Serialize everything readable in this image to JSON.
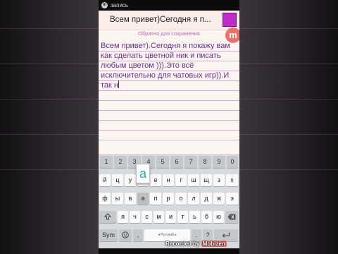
{
  "status_bar": {
    "recording_label": "запись",
    "recording_icon": "m"
  },
  "header": {
    "title": "Всем привет)Сегодня я п...",
    "selected_color": "#c02ac6"
  },
  "hint": "Обратно для сохранения",
  "badge": "m",
  "editor": {
    "text": "Всем привет).Сегодня я покажу вам как сделать цветной ник и писать любым цветом ))).Это всё исключительно для чатовых игр)).И так н"
  },
  "keyboard": {
    "popup": "а",
    "numbers": [
      "1",
      "2",
      "3",
      "4",
      "5",
      "6",
      "7",
      "8",
      "9",
      "0"
    ],
    "row1": [
      "й",
      "ц",
      "у",
      "к",
      "е",
      "н",
      "г",
      "ш",
      "щ",
      "з",
      "х"
    ],
    "row2": [
      "ф",
      "ы",
      "в",
      "а",
      "п",
      "р",
      "о",
      "л",
      "д",
      "ж",
      "э"
    ],
    "row3": [
      "я",
      "ч",
      "с",
      "м",
      "и",
      "т",
      "ь",
      "б",
      "ю"
    ],
    "sym": "Sym",
    "space": "◂ Русский ▸",
    "comma": ",",
    "period": ".",
    "question": "?"
  },
  "watermark": {
    "prefix": "Recorded by",
    "brand": "Mobizen"
  }
}
